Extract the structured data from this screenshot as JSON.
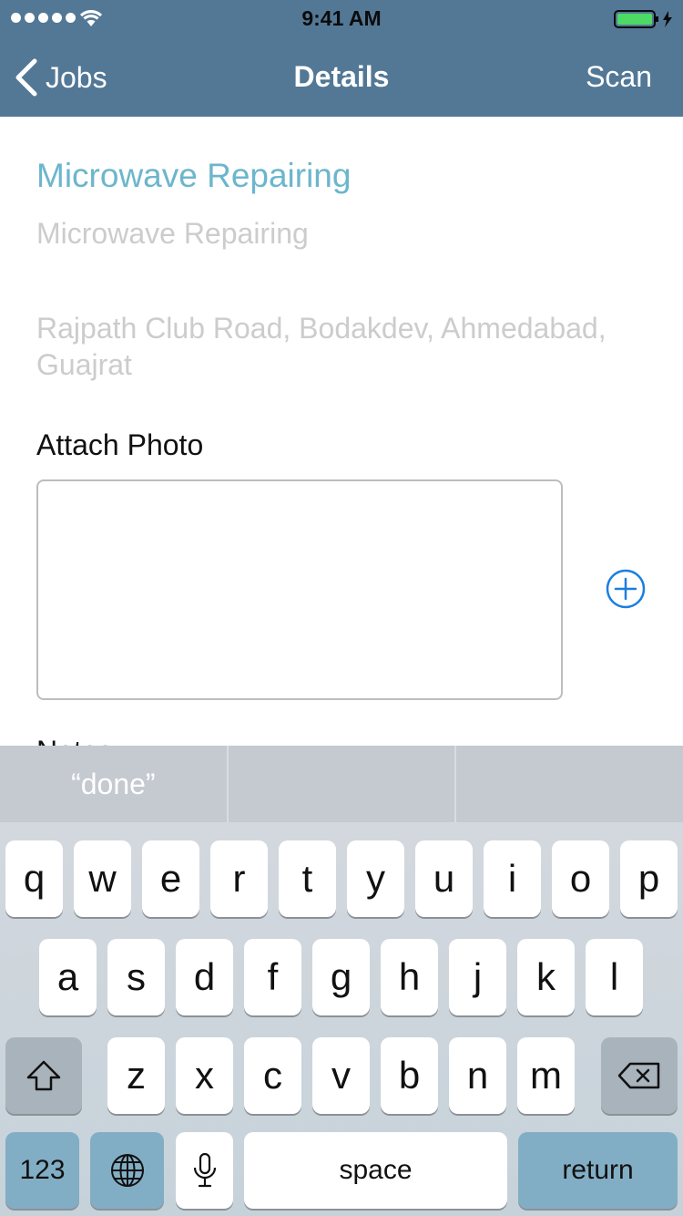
{
  "status_bar": {
    "time": "9:41 AM"
  },
  "nav": {
    "back_label": "Jobs",
    "title": "Details",
    "scan_label": "Scan"
  },
  "job": {
    "title": "Microwave Repairing",
    "subtitle": "Microwave Repairing",
    "address": "Rajpath Club Road, Bodakdev, Ahmedabad, Guajrat"
  },
  "attach": {
    "label": "Attach Photo"
  },
  "notes": {
    "label": "Notes"
  },
  "predictive": {
    "suggestions": [
      "“done”",
      "",
      ""
    ]
  },
  "keyboard": {
    "row1": [
      "q",
      "w",
      "e",
      "r",
      "t",
      "y",
      "u",
      "i",
      "o",
      "p"
    ],
    "row2": [
      "a",
      "s",
      "d",
      "f",
      "g",
      "h",
      "j",
      "k",
      "l"
    ],
    "row3": [
      "z",
      "x",
      "c",
      "v",
      "b",
      "n",
      "m"
    ],
    "numbers_label": "123",
    "space_label": "space",
    "return_label": "return"
  },
  "colors": {
    "nav_bar": "#527896",
    "accent_title": "#6cb6cc",
    "add_icon": "#1a7fe0",
    "battery": "#4cd964"
  },
  "icons": {
    "back": "chevron-left-icon",
    "add_photo": "plus-circle-icon",
    "shift": "shift-arrow-icon",
    "delete": "backspace-icon",
    "globe": "globe-icon",
    "mic": "microphone-icon"
  }
}
